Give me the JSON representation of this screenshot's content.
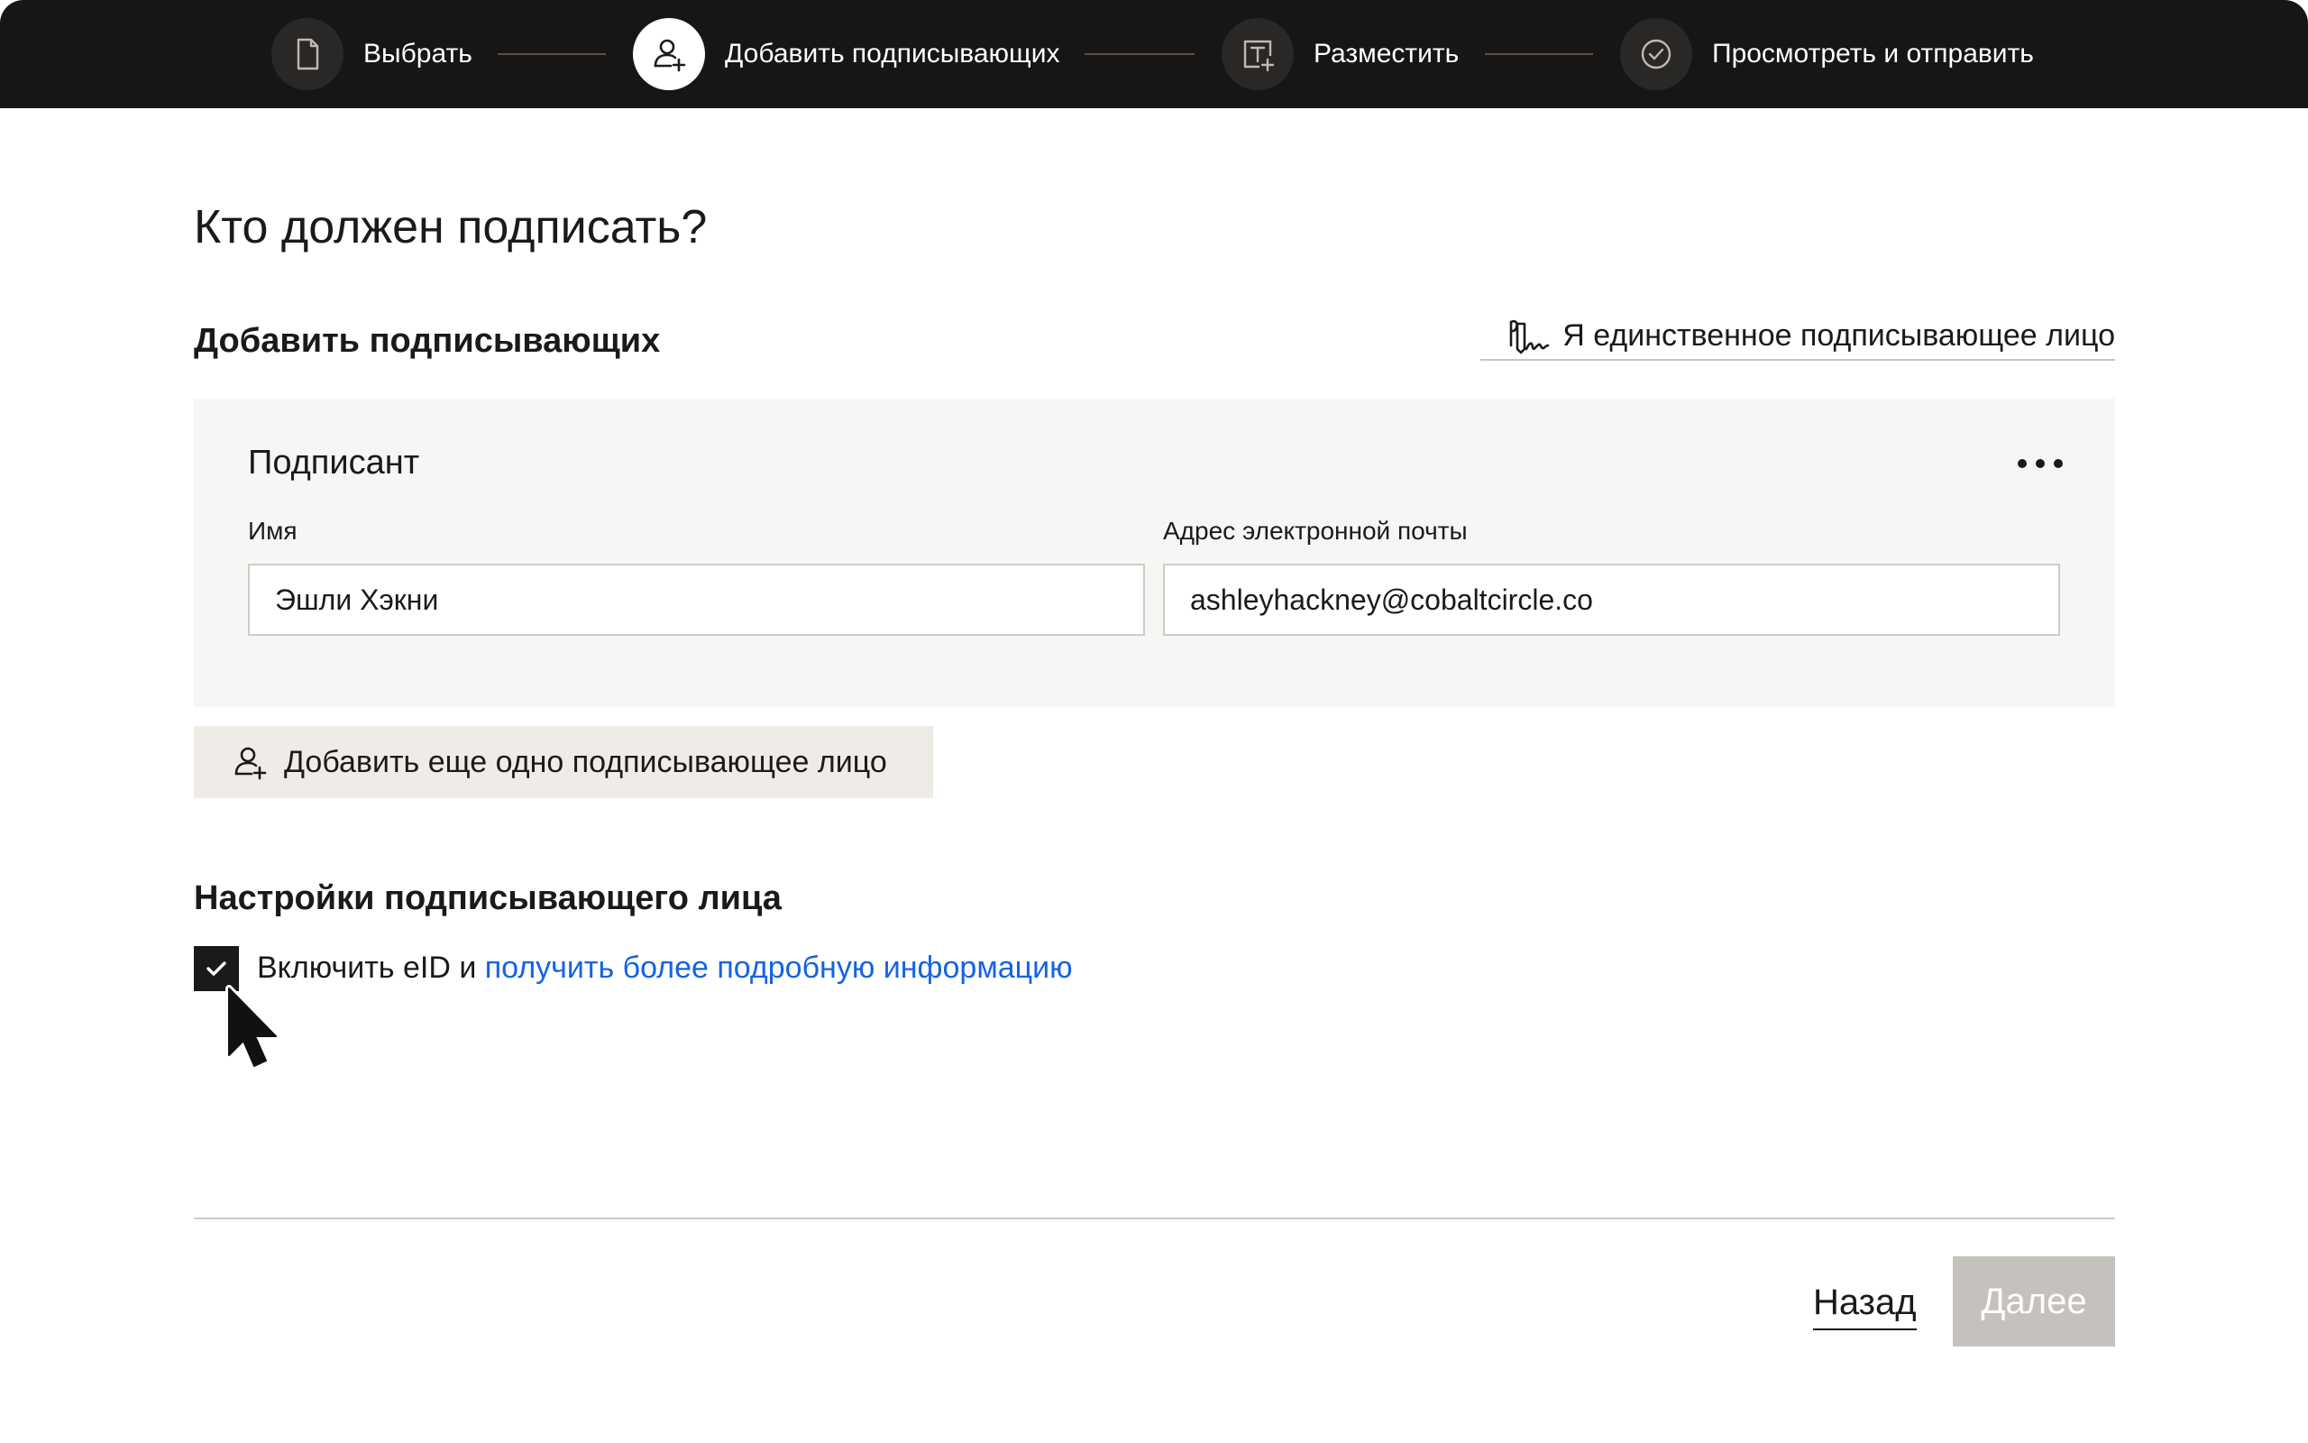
{
  "stepper": {
    "steps": [
      {
        "label": "Выбрать",
        "icon": "document-icon",
        "state": "done"
      },
      {
        "label": "Добавить подписывающих",
        "icon": "add-user-icon",
        "state": "active"
      },
      {
        "label": "Разместить",
        "icon": "text-field-add-icon",
        "state": "upcoming"
      },
      {
        "label": "Просмотреть и отправить",
        "icon": "check-circle-icon",
        "state": "upcoming"
      }
    ]
  },
  "page": {
    "title": "Кто должен подписать?",
    "section_title": "Добавить подписывающих",
    "only_signer_label": "Я единственное подписывающее лицо",
    "only_signer_icon": "signature-icon"
  },
  "signer_card": {
    "title": "Подписант",
    "more_icon": "more-horizontal-icon",
    "name_label": "Имя",
    "name_value": "Эшли Хэкни",
    "email_label": "Адрес электронной почты",
    "email_value": "ashleyhackney@cobaltcircle.co"
  },
  "add_signer": {
    "label": "Добавить еще одно подписывающее лицо",
    "icon": "add-user-icon"
  },
  "settings": {
    "title": "Настройки подписывающего лица",
    "eid_checked": true,
    "eid_text": "Включить eID и ",
    "eid_link": "получить более подробную информацию"
  },
  "footer": {
    "back_label": "Назад",
    "next_label": "Далее"
  },
  "colors": {
    "topbar": "#171614",
    "link": "#1463e6",
    "card_bg": "#f7f6f4",
    "disabled_button": "#c5c1bc"
  }
}
